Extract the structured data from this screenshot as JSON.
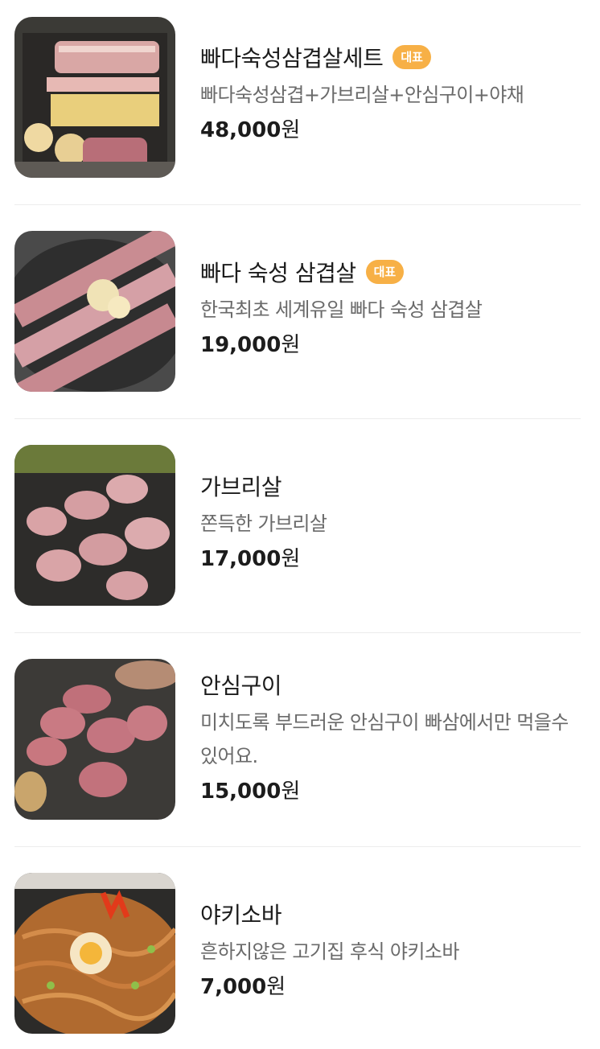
{
  "menu": {
    "items": [
      {
        "name": "빠다숙성삼겹살세트",
        "badge": "대표",
        "description": "빠다숙성삼겹+가브리살+안심구이+야채",
        "price": "48,000",
        "currency": "원",
        "image": "pork-set-grill"
      },
      {
        "name": "빠다 숙성 삼겹살",
        "badge": "대표",
        "description": "한국최초 세계유일 빠다 숙성 삼겹살",
        "price": "19,000",
        "currency": "원",
        "image": "pork-belly-grill"
      },
      {
        "name": "가브리살",
        "description": "쫀득한 가브리살",
        "price": "17,000",
        "currency": "원",
        "image": "gabrisal-grill"
      },
      {
        "name": "안심구이",
        "description": "미치도록 부드러운 안심구이 빠삼에서만 먹을수있어요.",
        "price": "15,000",
        "currency": "원",
        "image": "tenderloin-grill"
      },
      {
        "name": "야키소바",
        "description": "흔하지않은 고기집 후식 야키소바",
        "price": "7,000",
        "currency": "원",
        "image": "yakisoba-pan"
      }
    ]
  },
  "colors": {
    "badge": "#f7b046",
    "divider": "#ececec",
    "description": "#6a6a6a"
  }
}
